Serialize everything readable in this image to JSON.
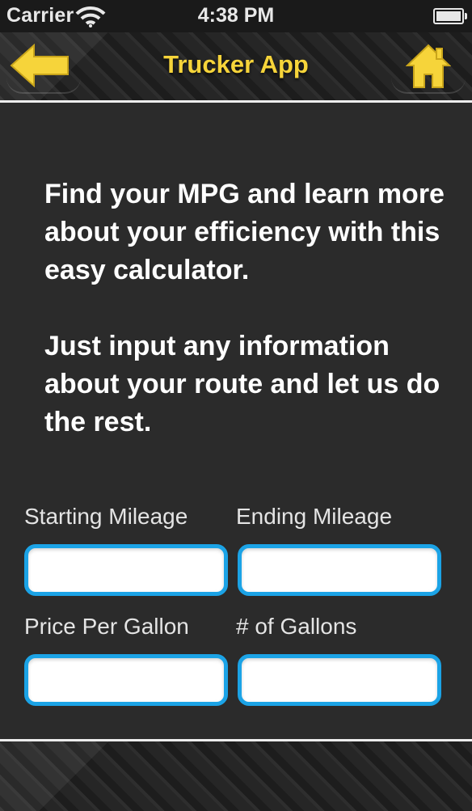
{
  "status_bar": {
    "carrier": "Carrier",
    "time": "4:38 PM",
    "battery_level": 1.0
  },
  "nav": {
    "title": "Trucker App",
    "back_icon": "back-arrow-icon",
    "home_icon": "home-icon",
    "accent_color": "#f6d43a"
  },
  "intro": {
    "paragraph1": "Find your MPG and learn more about your efficiency with this easy calculator.",
    "paragraph2": "Just input any information about your route and let us do the rest."
  },
  "form": {
    "starting_mileage": {
      "label": "Starting Mileage",
      "value": ""
    },
    "ending_mileage": {
      "label": "Ending Mileage",
      "value": ""
    },
    "price_per_gallon": {
      "label": "Price Per Gallon",
      "value": ""
    },
    "num_gallons": {
      "label": "# of Gallons",
      "value": ""
    },
    "field_border_color": "#1ba3e6"
  }
}
